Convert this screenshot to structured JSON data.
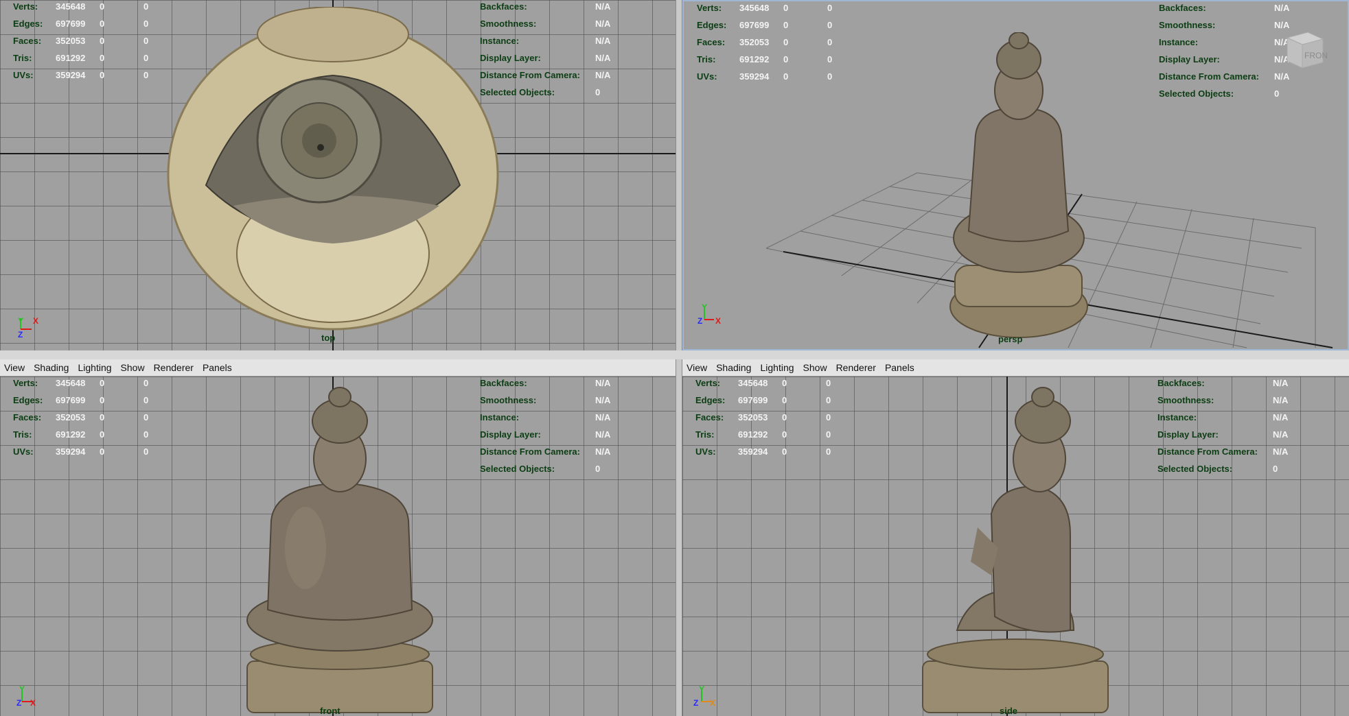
{
  "menu": [
    "View",
    "Shading",
    "Lighting",
    "Show",
    "Renderer",
    "Panels"
  ],
  "hud_stats": [
    {
      "label": "Verts:",
      "values": [
        "345648",
        "0",
        "0"
      ]
    },
    {
      "label": "Edges:",
      "values": [
        "697699",
        "0",
        "0"
      ]
    },
    {
      "label": "Faces:",
      "values": [
        "352053",
        "0",
        "0"
      ]
    },
    {
      "label": "Tris:",
      "values": [
        "691292",
        "0",
        "0"
      ]
    },
    {
      "label": "UVs:",
      "values": [
        "359294",
        "0",
        "0"
      ]
    }
  ],
  "hud_info": [
    {
      "label": "Backfaces:",
      "value": "N/A"
    },
    {
      "label": "Smoothness:",
      "value": "N/A"
    },
    {
      "label": "Instance:",
      "value": "N/A"
    },
    {
      "label": "Display Layer:",
      "value": "N/A"
    },
    {
      "label": "Distance From Camera:",
      "value": "N/A"
    },
    {
      "label": "Selected Objects:",
      "value": "0"
    }
  ],
  "viewports": {
    "top": {
      "camera": "top"
    },
    "persp": {
      "camera": "persp"
    },
    "front": {
      "camera": "front"
    },
    "side": {
      "camera": "side"
    }
  },
  "view_cube": {
    "face": "FRONT"
  },
  "axes": {
    "x": "X",
    "y": "Y",
    "z": "Z"
  },
  "colors": {
    "viewport_bg": "#a0a0a0",
    "hud_label": "#0b3d12",
    "hud_value": "#f4f4f4",
    "axis_x": "#e01818",
    "axis_y": "#22c422",
    "axis_z": "#2a2aff"
  }
}
